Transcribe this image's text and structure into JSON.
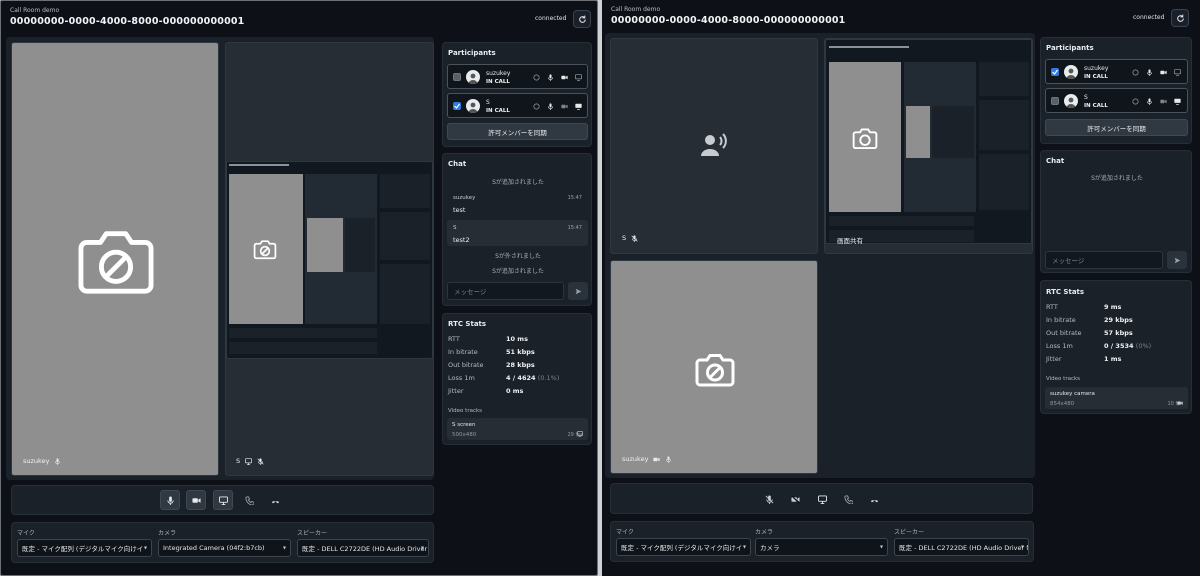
{
  "colors": {
    "background": "#0d1117",
    "panel": "#1b2129",
    "tile_gray": "#8f8f8f",
    "tile_dark": "#262d35",
    "checkbox_checked": "#2f7be5"
  },
  "left": {
    "header": {
      "small": "Call Room demo",
      "title": "00000000-0000-4000-8000-000000000001",
      "status": "connected"
    },
    "tiles": [
      {
        "name": "suzukey",
        "icons": [
          "mic-icon"
        ],
        "state": "camera-off"
      },
      {
        "name": "S",
        "icons": [
          "screen-share-icon",
          "mic-off-icon"
        ],
        "state": "screen-share"
      }
    ],
    "participants": {
      "title": "Participants",
      "items": [
        {
          "name": "suzukey",
          "status": "IN CALL",
          "checked": false
        },
        {
          "name": "S",
          "status": "IN CALL",
          "checked": true
        }
      ],
      "sync_button": "許可メンバーを同期"
    },
    "chat": {
      "title": "Chat",
      "sys1": "Sが追加されました",
      "messages": [
        {
          "who": "suzukey",
          "time": "15:47",
          "text": "test"
        },
        {
          "who": "S",
          "time": "15:47",
          "text": "test2"
        }
      ],
      "sys2": "Sが外されました",
      "sys3": "Sが追加されました",
      "placeholder": "メッセージ"
    },
    "stats": {
      "title": "RTC Stats",
      "rows": [
        {
          "label": "RTT",
          "value": "10 ms",
          "sub": ""
        },
        {
          "label": "In bitrate",
          "value": "51 kbps",
          "sub": ""
        },
        {
          "label": "Out bitrate",
          "value": "28 kbps",
          "sub": ""
        },
        {
          "label": "Loss 1m",
          "value": "4 / 4624",
          "sub": "(0.1%)"
        },
        {
          "label": "Jitter",
          "value": "0 ms",
          "sub": ""
        }
      ],
      "video_tracks_title": "Video tracks",
      "track": {
        "name": "S screen",
        "res": "500x480",
        "fps": "29 fps",
        "icon": "screen-share-icon"
      }
    },
    "devices": {
      "mic_label": "マイク",
      "mic_value": "既定 - マイク配列 (デジタルマイク向けイ",
      "cam_label": "カメラ",
      "cam_value": "Integrated Camera (04f2:b7cb)",
      "spk_label": "スピーカー",
      "spk_value": "既定 - DELL C2722DE (HD Audio Driver fo"
    }
  },
  "right": {
    "header": {
      "small": "Call Room demo",
      "title": "00000000-0000-4000-8000-000000000001",
      "status": "connected"
    },
    "tiles": [
      {
        "name": "S",
        "icons": [
          "mic-off-icon"
        ],
        "state": "audio-only"
      },
      {
        "name": "画面共有",
        "icons": [],
        "state": "screen-share"
      },
      {
        "name": "suzukey",
        "icons": [
          "camera-icon",
          "mic-icon"
        ],
        "state": "camera-off"
      }
    ],
    "participants": {
      "title": "Participants",
      "items": [
        {
          "name": "suzukey",
          "status": "IN CALL",
          "checked": true
        },
        {
          "name": "S",
          "status": "IN CALL",
          "checked": false
        }
      ],
      "sync_button": "許可メンバーを同期"
    },
    "chat": {
      "title": "Chat",
      "sys1": "Sが追加されました",
      "placeholder": "メッセージ"
    },
    "stats": {
      "title": "RTC Stats",
      "rows": [
        {
          "label": "RTT",
          "value": "9 ms",
          "sub": ""
        },
        {
          "label": "In bitrate",
          "value": "29 kbps",
          "sub": ""
        },
        {
          "label": "Out bitrate",
          "value": "57 kbps",
          "sub": ""
        },
        {
          "label": "Loss 1m",
          "value": "0 / 3534",
          "sub": "(0%)"
        },
        {
          "label": "Jitter",
          "value": "1 ms",
          "sub": ""
        }
      ],
      "video_tracks_title": "Video tracks",
      "track": {
        "name": "suzukey camera",
        "res": "854x480",
        "fps": "10 fps",
        "icon": "camera-icon"
      }
    },
    "devices": {
      "mic_label": "マイク",
      "mic_value": "既定 - マイク配列 (デジタルマイク向けイ",
      "cam_label": "カメラ",
      "cam_value": "カメラ",
      "spk_label": "スピーカー",
      "spk_value": "既定 - DELL C2722DE (HD Audio Driver fo"
    }
  }
}
